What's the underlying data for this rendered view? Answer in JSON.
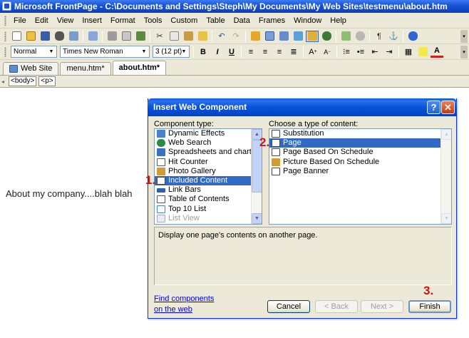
{
  "window": {
    "title": "Microsoft FrontPage - C:\\Documents and Settings\\Steph\\My Documents\\My Web Sites\\testmenu\\about.htm"
  },
  "menubar": [
    "File",
    "Edit",
    "View",
    "Insert",
    "Format",
    "Tools",
    "Custom",
    "Table",
    "Data",
    "Frames",
    "Window",
    "Help"
  ],
  "format_toolbar": {
    "style": "Normal",
    "font": "Times New Roman",
    "size": "3 (12 pt)"
  },
  "tabs": [
    "Web Site",
    "menu.htm*",
    "about.htm*"
  ],
  "quick_tags": [
    "<body>",
    "<p>"
  ],
  "page": {
    "text": "About my company....blah blah"
  },
  "dialog": {
    "title": "Insert Web Component",
    "component_type_label": "Component type:",
    "content_type_label": "Choose a type of content:",
    "components": [
      "Dynamic Effects",
      "Web Search",
      "Spreadsheets and charts",
      "Hit Counter",
      "Photo Gallery",
      "Included Content",
      "Link Bars",
      "Table of Contents",
      "Top 10 List",
      "List View"
    ],
    "selected_component": "Included Content",
    "content_types": [
      "Substitution",
      "Page",
      "Page Based On Schedule",
      "Picture Based On Schedule",
      "Page Banner"
    ],
    "selected_content": "Page",
    "description": "Display one page's contents on another page.",
    "find_link_line1": "Find components",
    "find_link_line2": "on the web",
    "buttons": {
      "cancel": "Cancel",
      "back": "< Back",
      "next": "Next >",
      "finish": "Finish"
    }
  },
  "annotations": {
    "step1": "1.",
    "step2": "2.",
    "step3": "3."
  },
  "colors": {
    "titlebar": "#0a3fbf",
    "selection": "#316ac5",
    "annotation_red": "#c81616",
    "dialog_bg": "#ece9d8"
  }
}
